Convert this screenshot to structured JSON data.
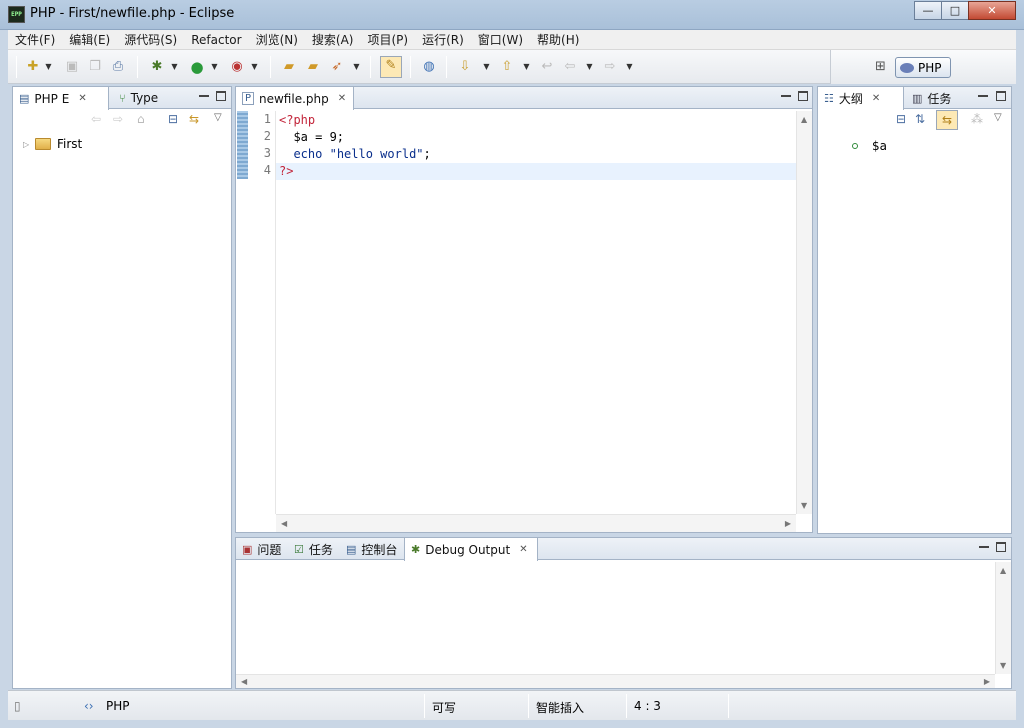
{
  "window": {
    "title": "PHP  -  First/newfile.php  -  Eclipse",
    "icon_text": "EPP",
    "minimize": "—",
    "maximize": "□",
    "close": "✕"
  },
  "menu": [
    "文件(F)",
    "编辑(E)",
    "源代码(S)",
    "Refactor",
    "浏览(N)",
    "搜索(A)",
    "项目(P)",
    "运行(R)",
    "窗口(W)",
    "帮助(H)"
  ],
  "perspective": {
    "label": "PHP"
  },
  "left_panel": {
    "tabs": [
      {
        "label": "PHP E",
        "icon": "package-explorer-icon",
        "closable": true
      },
      {
        "label": "Type",
        "icon": "type-hierarchy-icon",
        "closable": false
      }
    ],
    "tree": [
      {
        "label": "First",
        "icon": "project-folder-icon"
      }
    ]
  },
  "editor": {
    "tab": {
      "label": "newfile.php",
      "icon": "php-file-icon"
    },
    "line_numbers": [
      "1",
      "2",
      "3",
      "4"
    ],
    "lines": [
      {
        "parts": [
          {
            "t": "<?php",
            "c": "kw-tag"
          }
        ]
      },
      {
        "parts": [
          {
            "t": "  $a = 9;",
            "c": "var"
          }
        ]
      },
      {
        "parts": [
          {
            "t": "  echo",
            "c": "kw"
          },
          {
            "t": " ",
            "c": "var"
          },
          {
            "t": "\"hello world\"",
            "c": "str"
          },
          {
            "t": ";",
            "c": "var"
          }
        ]
      },
      {
        "parts": [
          {
            "t": "?>",
            "c": "kw-tag"
          }
        ],
        "current": true
      }
    ]
  },
  "right_panel": {
    "tabs": [
      {
        "label": "大纲",
        "icon": "outline-icon",
        "closable": true
      },
      {
        "label": "任务",
        "icon": "tasks-icon",
        "closable": false
      }
    ],
    "outline": [
      {
        "label": "$a",
        "icon": "variable-icon"
      }
    ]
  },
  "bottom_panel": {
    "tabs": [
      {
        "label": "问题",
        "icon": "problems-icon"
      },
      {
        "label": "任务",
        "icon": "tasks-icon"
      },
      {
        "label": "控制台",
        "icon": "console-icon"
      },
      {
        "label": "Debug Output",
        "icon": "debug-output-icon",
        "closable": true
      }
    ]
  },
  "status": {
    "context": "PHP",
    "writable": "可写",
    "insert_mode": "智能插入",
    "position": "4 : 3"
  }
}
